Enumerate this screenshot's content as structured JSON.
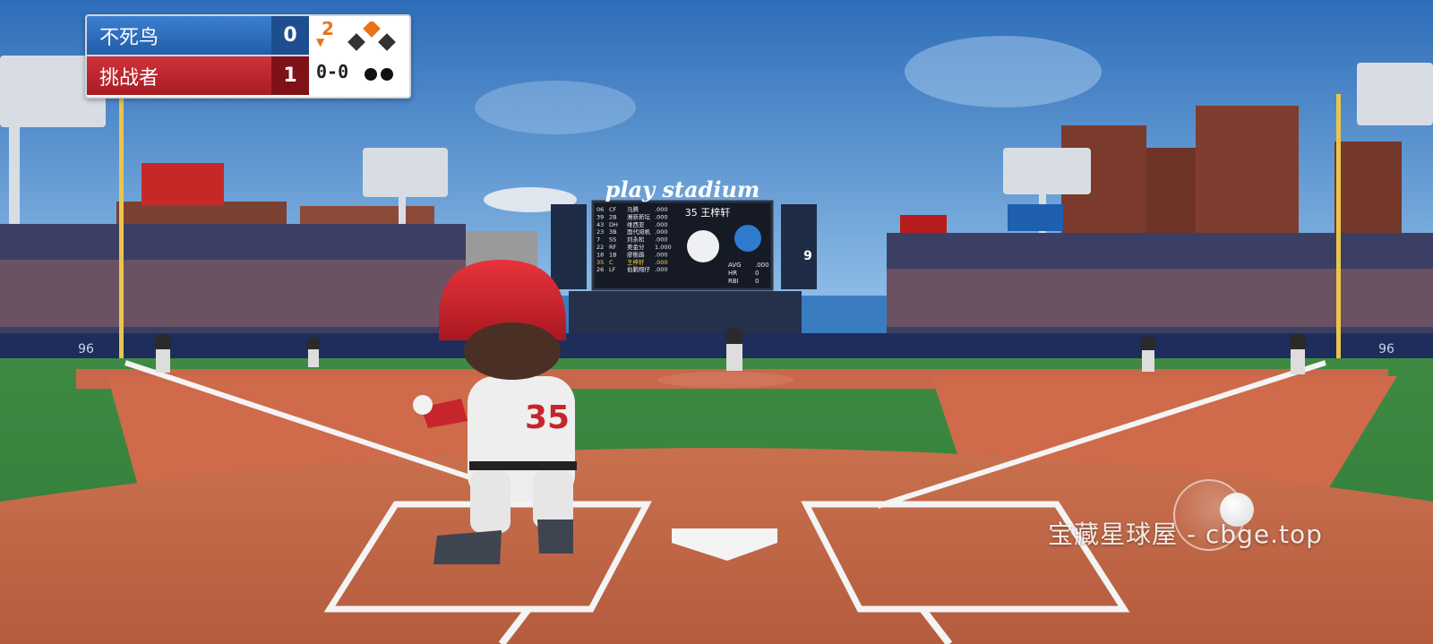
{
  "scoreboard": {
    "away": {
      "name": "不死鸟",
      "score": "0",
      "color": "#2f6fc0"
    },
    "home": {
      "name": "挑战者",
      "score": "1",
      "color": "#c4252c"
    },
    "inning": "2",
    "inning_half": "top",
    "bases": {
      "first": false,
      "second": true,
      "third": false
    },
    "count": "0-0",
    "outs": 2,
    "inning_color": "#e8731b"
  },
  "stadium": {
    "sign": "play stadium",
    "wall_numbers": {
      "left": "96",
      "right": "96"
    },
    "jumbotron": {
      "player_header": "35 王梓轩",
      "stats": [
        {
          "label": "AVG",
          "value": ".000"
        },
        {
          "label": "HR",
          "value": "0"
        },
        {
          "label": "RBI",
          "value": "0"
        }
      ],
      "lineup": [
        {
          "order": "06",
          "pos": "CF",
          "name": "马腾",
          "avg": ".000"
        },
        {
          "order": "39",
          "pos": "2B",
          "name": "潮新新坛",
          "avg": ".000"
        },
        {
          "order": "43",
          "pos": "DH",
          "name": "维西亚",
          "avg": ".000"
        },
        {
          "order": "23",
          "pos": "3B",
          "name": "面代阅帆",
          "avg": ".000"
        },
        {
          "order": "7",
          "pos": "SS",
          "name": "刘永松",
          "avg": ".000"
        },
        {
          "order": "22",
          "pos": "RF",
          "name": "奥金分",
          "avg": "1.000"
        },
        {
          "order": "18",
          "pos": "1B",
          "name": "廖衡路",
          "avg": ".000"
        },
        {
          "order": "35",
          "pos": "C",
          "name": "王梓轩",
          "avg": ".000"
        },
        {
          "order": "26",
          "pos": "LF",
          "name": "伯鹏翔仔",
          "avg": ".000"
        }
      ]
    },
    "side_board_number": "9"
  },
  "batter": {
    "number": "35"
  },
  "watermark": "宝藏星球屋 - cbge.top"
}
